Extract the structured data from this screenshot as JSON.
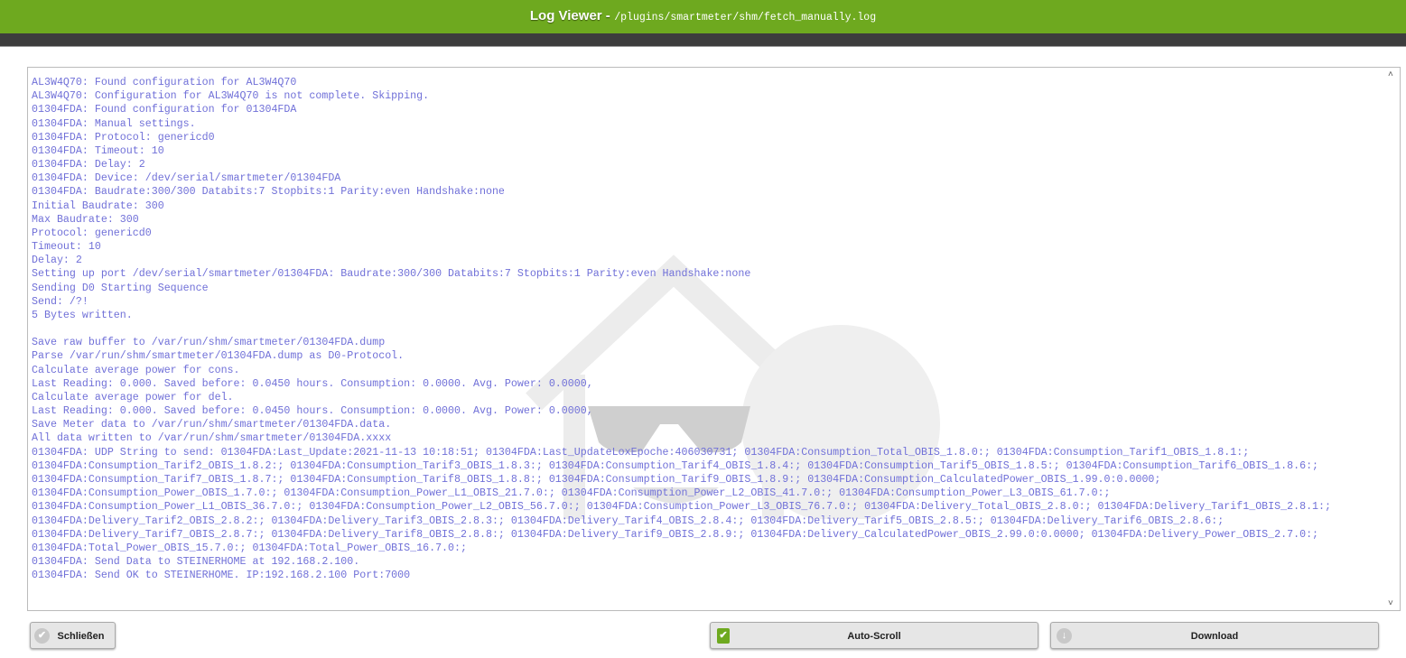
{
  "header": {
    "title": "Log Viewer -",
    "path": "/plugins/smartmeter/shm/fetch_manually.log"
  },
  "log": {
    "lines": [
      "AL3W4Q70: Found configuration for AL3W4Q70",
      "AL3W4Q70: Configuration for AL3W4Q70 is not complete. Skipping.",
      "01304FDA: Found configuration for 01304FDA",
      "01304FDA: Manual settings.",
      "01304FDA: Protocol: genericd0",
      "01304FDA: Timeout: 10",
      "01304FDA: Delay: 2",
      "01304FDA: Device: /dev/serial/smartmeter/01304FDA",
      "01304FDA: Baudrate:300/300 Databits:7 Stopbits:1 Parity:even Handshake:none",
      "Initial Baudrate: 300",
      "Max Baudrate: 300",
      "Protocol: genericd0",
      "Timeout: 10",
      "Delay: 2",
      "Setting up port /dev/serial/smartmeter/01304FDA: Baudrate:300/300 Databits:7 Stopbits:1 Parity:even Handshake:none",
      "Sending D0 Starting Sequence",
      "Send: /?!",
      "5 Bytes written.",
      "",
      "Save raw buffer to /var/run/shm/smartmeter/01304FDA.dump",
      "Parse /var/run/shm/smartmeter/01304FDA.dump as D0-Protocol.",
      "Calculate average power for cons.",
      "Last Reading: 0.000. Saved before: 0.0450 hours. Consumption: 0.0000. Avg. Power: 0.0000,",
      "Calculate average power for del.",
      "Last Reading: 0.000. Saved before: 0.0450 hours. Consumption: 0.0000. Avg. Power: 0.0000,",
      "Save Meter data to /var/run/shm/smartmeter/01304FDA.data.",
      "All data written to /var/run/shm/smartmeter/01304FDA.xxxx",
      "01304FDA: UDP String to send: 01304FDA:Last_Update:2021-11-13 10:18:51; 01304FDA:Last_UpdateLoxEpoche:406030731; 01304FDA:Consumption_Total_OBIS_1.8.0:; 01304FDA:Consumption_Tarif1_OBIS_1.8.1:;",
      "01304FDA:Consumption_Tarif2_OBIS_1.8.2:; 01304FDA:Consumption_Tarif3_OBIS_1.8.3:; 01304FDA:Consumption_Tarif4_OBIS_1.8.4:; 01304FDA:Consumption_Tarif5_OBIS_1.8.5:; 01304FDA:Consumption_Tarif6_OBIS_1.8.6:;",
      "01304FDA:Consumption_Tarif7_OBIS_1.8.7:; 01304FDA:Consumption_Tarif8_OBIS_1.8.8:; 01304FDA:Consumption_Tarif9_OBIS_1.8.9:; 01304FDA:Consumption_CalculatedPower_OBIS_1.99.0:0.0000;",
      "01304FDA:Consumption_Power_OBIS_1.7.0:; 01304FDA:Consumption_Power_L1_OBIS_21.7.0:; 01304FDA:Consumption_Power_L2_OBIS_41.7.0:; 01304FDA:Consumption_Power_L3_OBIS_61.7.0:;",
      "01304FDA:Consumption_Power_L1_OBIS_36.7.0:; 01304FDA:Consumption_Power_L2_OBIS_56.7.0:; 01304FDA:Consumption_Power_L3_OBIS_76.7.0:; 01304FDA:Delivery_Total_OBIS_2.8.0:; 01304FDA:Delivery_Tarif1_OBIS_2.8.1:;",
      "01304FDA:Delivery_Tarif2_OBIS_2.8.2:; 01304FDA:Delivery_Tarif3_OBIS_2.8.3:; 01304FDA:Delivery_Tarif4_OBIS_2.8.4:; 01304FDA:Delivery_Tarif5_OBIS_2.8.5:; 01304FDA:Delivery_Tarif6_OBIS_2.8.6:;",
      "01304FDA:Delivery_Tarif7_OBIS_2.8.7:; 01304FDA:Delivery_Tarif8_OBIS_2.8.8:; 01304FDA:Delivery_Tarif9_OBIS_2.8.9:; 01304FDA:Delivery_CalculatedPower_OBIS_2.99.0:0.0000; 01304FDA:Delivery_Power_OBIS_2.7.0:;",
      "01304FDA:Total_Power_OBIS_15.7.0:; 01304FDA:Total_Power_OBIS_16.7.0:;",
      "01304FDA: Send Data to STEINERHOME at 192.168.2.100.",
      "01304FDA: Send OK to STEINERHOME. IP:192.168.2.100 Port:7000"
    ]
  },
  "buttons": {
    "close": "Schließen",
    "autoscroll": "Auto-Scroll",
    "download": "Download"
  },
  "colors": {
    "header": "#6ea91f",
    "log_text": "#7070d8"
  }
}
